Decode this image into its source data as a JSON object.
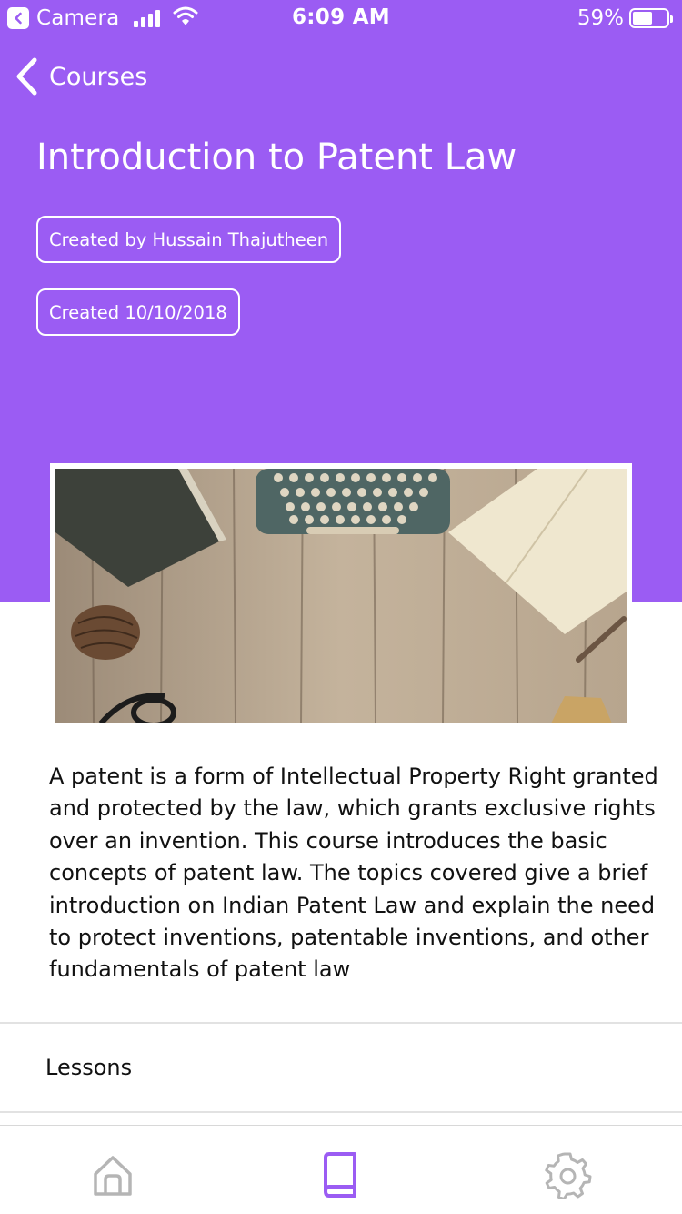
{
  "status_bar": {
    "app_label": "Camera",
    "time": "6:09 AM",
    "battery_percent": "59%",
    "battery_level": 0.59,
    "signal_icon": "cellular-signal-icon",
    "wifi_icon": "wifi-icon"
  },
  "nav": {
    "back_label": "Courses",
    "back_icon": "chevron-left-icon"
  },
  "course": {
    "title": "Introduction to Patent Law",
    "author_chip": "Created by Hussain Thajutheen",
    "date_chip": "Created 10/10/2018",
    "description": "A patent is a form of Intellectual Property Right granted and protected by the law, which grants exclusive rights over an invention. This course introduces the basic concepts of patent law. The topics covered give a brief introduction on Indian Patent Law and explain the need to protect inventions, patentable inventions, and other fundamentals of patent law"
  },
  "lessons": {
    "label": "Lessons"
  },
  "tab_bar": {
    "tabs": [
      {
        "icon": "home-icon",
        "active": false
      },
      {
        "icon": "book-icon",
        "active": true
      },
      {
        "icon": "gear-icon",
        "active": false
      }
    ]
  },
  "colors": {
    "accent": "#9b5cf3",
    "tab_inactive": "#b5b5b5",
    "tab_active": "#9b5cf3"
  }
}
